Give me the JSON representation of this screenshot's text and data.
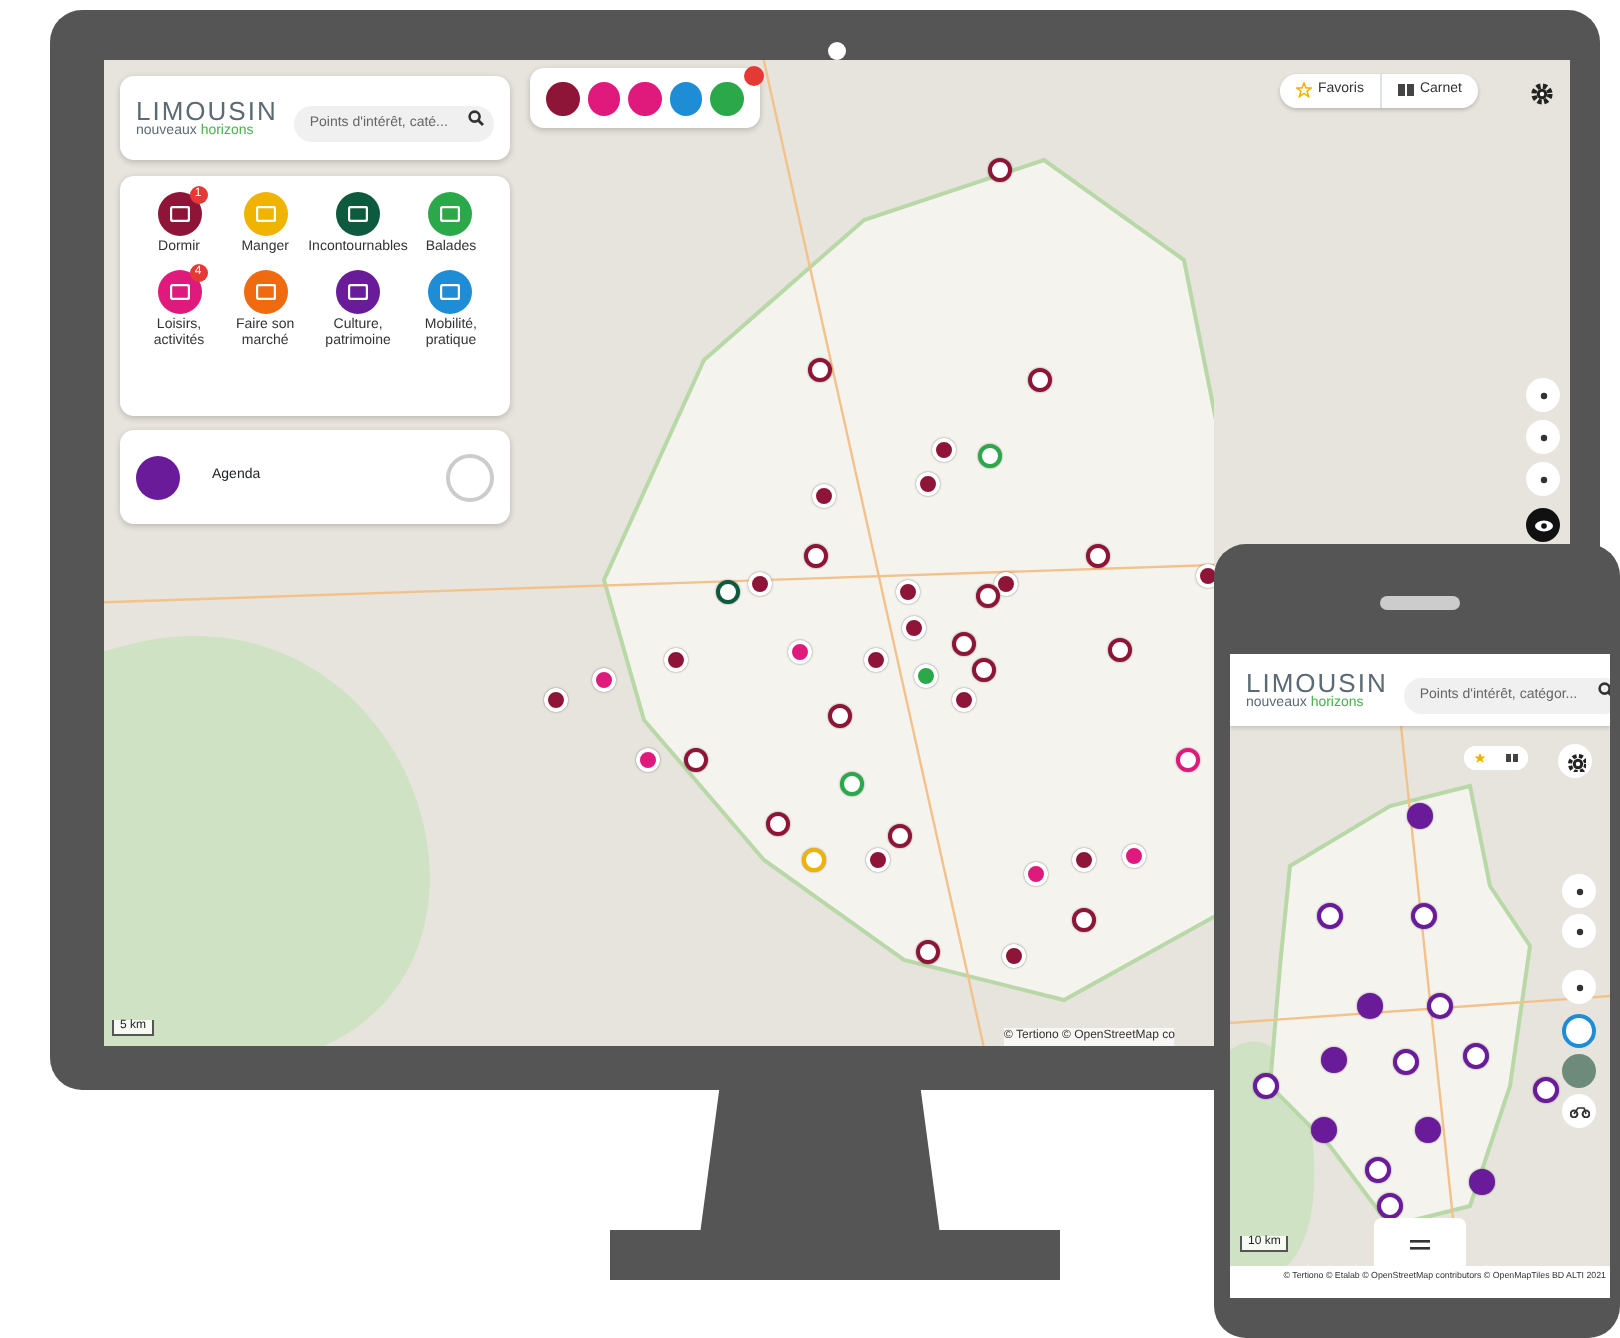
{
  "desktop": {
    "logo": {
      "title": "LIMOUSIN",
      "tagline_1": "nouveaux",
      "tagline_2": "horizons"
    },
    "search": {
      "placeholder": "Points d'intérêt, caté..."
    },
    "active_filters": [
      {
        "color": "#8e1537"
      },
      {
        "color": "#e0197d"
      },
      {
        "color": "#e0197d"
      },
      {
        "color": "#1f8dd6"
      },
      {
        "color": "#2ba84a"
      }
    ],
    "categories": [
      {
        "label": "Dormir",
        "color": "#8e1537",
        "badge": "1"
      },
      {
        "label": "Manger",
        "color": "#f0b400"
      },
      {
        "label": "Incontournables",
        "color": "#0e5a3e"
      },
      {
        "label": "Balades",
        "color": "#2ba84a"
      },
      {
        "label": "Loisirs, activités",
        "color": "#e0197d",
        "badge": "4"
      },
      {
        "label": "Faire son marché",
        "color": "#f06a10"
      },
      {
        "label": "Culture, patrimoine",
        "color": "#6a1b9a"
      },
      {
        "label": "Mobilité, pratique",
        "color": "#1f8dd6"
      }
    ],
    "agenda": {
      "label": "Agenda",
      "color": "#6a1b9a"
    },
    "top_buttons": [
      {
        "label": "Favoris",
        "kind": "star"
      },
      {
        "label": "Carnet",
        "kind": "book"
      }
    ],
    "scale": "5 km",
    "attribution": "© Tertiono © OpenStreetMap co"
  },
  "mobile": {
    "logo": {
      "title": "LIMOUSIN",
      "tagline_1": "nouveaux",
      "tagline_2": "horizons"
    },
    "search": {
      "placeholder": "Points d'intérêt, catégor..."
    },
    "scale": "10 km",
    "attribution": "© Tertiono © Etalab © OpenStreetMap contributors © OpenMapTiles BD ALTI 2021"
  }
}
